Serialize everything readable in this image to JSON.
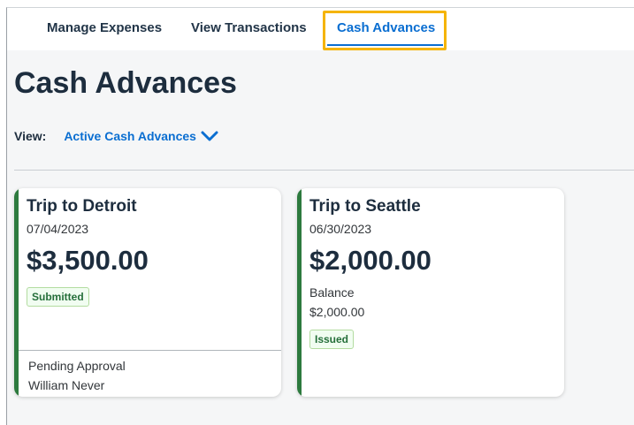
{
  "tabs": {
    "manage_expenses": "Manage Expenses",
    "view_transactions": "View Transactions",
    "cash_advances": "Cash Advances"
  },
  "page": {
    "title": "Cash Advances",
    "view_label": "View:",
    "view_selected": "Active Cash Advances"
  },
  "cards": [
    {
      "title": "Trip to Detroit",
      "date": "07/04/2023",
      "amount": "$3,500.00",
      "status": "Submitted",
      "footer_status": "Pending Approval",
      "approver": "William Never"
    },
    {
      "title": "Trip to Seattle",
      "date": "06/30/2023",
      "amount": "$2,000.00",
      "balance_label": "Balance",
      "balance_value": "$2,000.00",
      "status": "Issued"
    }
  ],
  "colors": {
    "accent_blue": "#0a6ed1",
    "highlight": "#f5b400",
    "card_accent_green": "#2d7a3e"
  },
  "icons": {
    "view_dropdown": "chevron-down-icon"
  }
}
